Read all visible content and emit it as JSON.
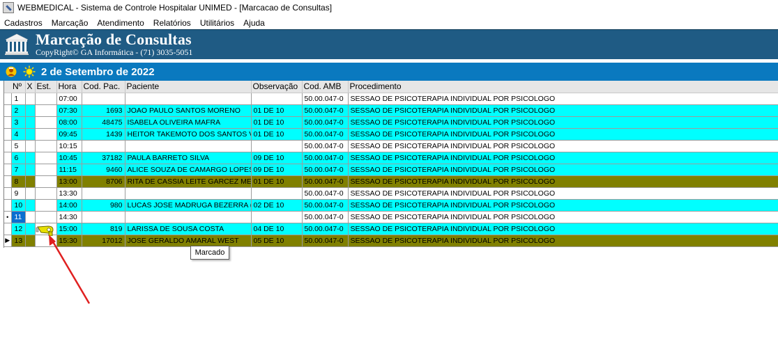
{
  "window": {
    "title": "WEBMEDICAL - Sistema de Controle Hospitalar UNIMED - [Marcacao de Consultas]",
    "icon": "app-icon"
  },
  "menu": [
    {
      "label": "Cadastros"
    },
    {
      "label": "Marcação"
    },
    {
      "label": "Atendimento"
    },
    {
      "label": "Relatórios"
    },
    {
      "label": "Utilitários"
    },
    {
      "label": "Ajuda"
    }
  ],
  "banner": {
    "title": "Marcação de Consultas",
    "subtitle": "CopyRight© GA Informática - (71) 3035-5051",
    "color": "#1f5b84"
  },
  "date_bar": {
    "date": "2 de Setembro de 2022",
    "color": "#0a79bf"
  },
  "grid": {
    "columns": [
      "Nº",
      "X",
      "Est.",
      "Hora",
      "Cod. Pac.",
      "Paciente",
      "Observação",
      "Cod. AMB",
      "Procedimento"
    ],
    "rows": [
      {
        "n": "1",
        "x": "",
        "est": "",
        "hora": "07:00",
        "codpac": "",
        "paciente": "",
        "obs": "",
        "amb": "50.00.047-0",
        "proc": "SESSAO DE PSICOTERAPIA INDIVIDUAL POR PSICOLOGO",
        "status": "white",
        "indicator": ""
      },
      {
        "n": "2",
        "x": "",
        "est": "",
        "hora": "07:30",
        "codpac": "1693",
        "paciente": "JOAO PAULO SANTOS MORENO",
        "obs": "01 DE 10",
        "amb": "50.00.047-0",
        "proc": "SESSAO DE PSICOTERAPIA INDIVIDUAL POR PSICOLOGO",
        "status": "cyan",
        "indicator": ""
      },
      {
        "n": "3",
        "x": "",
        "est": "",
        "hora": "08:00",
        "codpac": "48475",
        "paciente": "ISABELA OLIVEIRA MAFRA",
        "obs": "01 DE 10",
        "amb": "50.00.047-0",
        "proc": "SESSAO DE PSICOTERAPIA INDIVIDUAL POR PSICOLOGO",
        "status": "cyan",
        "indicator": ""
      },
      {
        "n": "4",
        "x": "",
        "est": "",
        "hora": "09:45",
        "codpac": "1439",
        "paciente": "HEITOR TAKEMOTO DOS SANTOS V",
        "obs": "01 DE 10",
        "amb": "50.00.047-0",
        "proc": "SESSAO DE PSICOTERAPIA INDIVIDUAL POR PSICOLOGO",
        "status": "cyan",
        "indicator": ""
      },
      {
        "n": "5",
        "x": "",
        "est": "",
        "hora": "10:15",
        "codpac": "",
        "paciente": "",
        "obs": "",
        "amb": "50.00.047-0",
        "proc": "SESSAO DE PSICOTERAPIA INDIVIDUAL POR PSICOLOGO",
        "status": "white",
        "indicator": ""
      },
      {
        "n": "6",
        "x": "",
        "est": "",
        "hora": "10:45",
        "codpac": "37182",
        "paciente": "PAULA BARRETO SILVA",
        "obs": "09 DE 10",
        "amb": "50.00.047-0",
        "proc": "SESSAO DE PSICOTERAPIA INDIVIDUAL POR PSICOLOGO",
        "status": "cyan",
        "indicator": ""
      },
      {
        "n": "7",
        "x": "",
        "est": "",
        "hora": "11:15",
        "codpac": "9460",
        "paciente": "ALICE SOUZA DE CAMARGO LOPES",
        "obs": "09 DE 10",
        "amb": "50.00.047-0",
        "proc": "SESSAO DE PSICOTERAPIA INDIVIDUAL POR PSICOLOGO",
        "status": "cyan",
        "indicator": ""
      },
      {
        "n": "8",
        "x": "",
        "est": "",
        "hora": "13:00",
        "codpac": "8706",
        "paciente": "RITA DE CASSIA LEITE GARCEZ MEI",
        "obs": "01 DE 10",
        "amb": "50.00.047-0",
        "proc": "SESSAO DE PSICOTERAPIA INDIVIDUAL POR PSICOLOGO",
        "status": "olive",
        "indicator": ""
      },
      {
        "n": "9",
        "x": "",
        "est": "",
        "hora": "13:30",
        "codpac": "",
        "paciente": "",
        "obs": "",
        "amb": "50.00.047-0",
        "proc": "SESSAO DE PSICOTERAPIA INDIVIDUAL POR PSICOLOGO",
        "status": "white",
        "indicator": ""
      },
      {
        "n": "10",
        "x": "",
        "est": "",
        "hora": "14:00",
        "codpac": "980",
        "paciente": "LUCAS JOSE MADRUGA BEZERRA (",
        "obs": "02 DE 10",
        "amb": "50.00.047-0",
        "proc": "SESSAO DE PSICOTERAPIA INDIVIDUAL POR PSICOLOGO",
        "status": "cyan",
        "indicator": ""
      },
      {
        "n": "11",
        "x": "",
        "est": "",
        "hora": "14:30",
        "codpac": "",
        "paciente": "",
        "obs": "",
        "amb": "50.00.047-0",
        "proc": "SESSAO DE PSICOTERAPIA INDIVIDUAL POR PSICOLOGO",
        "status": "white",
        "indicator": "•",
        "selected": true
      },
      {
        "n": "12",
        "x": "",
        "est": "",
        "hora": "15:00",
        "codpac": "819",
        "paciente": "LARISSA DE SOUSA COSTA",
        "obs": "04 DE 10",
        "amb": "50.00.047-0",
        "proc": "SESSAO DE PSICOTERAPIA INDIVIDUAL POR PSICOLOGO",
        "status": "cyan",
        "indicator": ""
      },
      {
        "n": "13",
        "x": "",
        "est": "",
        "hora": "15:30",
        "codpac": "17012",
        "paciente": "JOSE GERALDO AMARAL WEST",
        "obs": "05 DE 10",
        "amb": "50.00.047-0",
        "proc": "SESSAO DE PSICOTERAPIA INDIVIDUAL POR PSICOLOGO",
        "status": "olive",
        "indicator": "▶"
      }
    ]
  },
  "tooltip": {
    "text": "Marcado"
  },
  "colors": {
    "cyan": "#00ffff",
    "olive": "#808000",
    "selected": "#0a6fd0",
    "arrow": "#e02020"
  }
}
